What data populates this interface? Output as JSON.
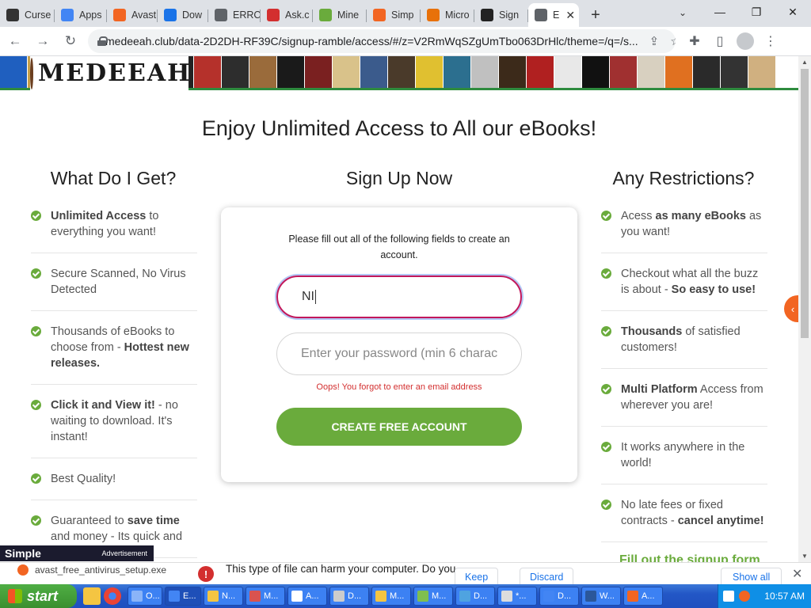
{
  "browser": {
    "tabs": [
      {
        "label": "Curse",
        "icon": "cursor-icon",
        "color": "#333333"
      },
      {
        "label": "Apps",
        "icon": "apps-grid-icon",
        "color": "#4285f4"
      },
      {
        "label": "Avast",
        "icon": "avast-icon",
        "color": "#f26522"
      },
      {
        "label": "Dow",
        "icon": "download-icon",
        "color": "#1a73e8"
      },
      {
        "label": "ERRC",
        "icon": "globe-icon",
        "color": "#5f6368"
      },
      {
        "label": "Ask.c",
        "icon": "ask-icon",
        "color": "#d32f2f"
      },
      {
        "label": "Mine",
        "icon": "dp-icon",
        "color": "#6aab3c"
      },
      {
        "label": "Simp",
        "icon": "simple-icon",
        "color": "#f26522"
      },
      {
        "label": "Micro",
        "icon": "rainbow-icon",
        "color": "#e8710a"
      },
      {
        "label": "Sign",
        "icon": "github-icon",
        "color": "#222222"
      },
      {
        "label": "E",
        "icon": "page-icon",
        "color": "#5f6368"
      }
    ],
    "url": "medeeah.club/data-2D2DH-RF39C/signup-ramble/access/#/z=V2RmWqSZgUmTbo063DrHlc/theme=/q=/s..."
  },
  "site": {
    "logo_text": "MEDEEAH",
    "headline": "Enjoy Unlimited Access to All our eBooks!",
    "left_title": "What Do I Get?",
    "center_title": "Sign Up Now",
    "right_title": "Any Restrictions?",
    "left_features": [
      {
        "bold": "Unlimited Access",
        "rest": " to everything you want!"
      },
      {
        "bold": "",
        "rest": "Secure Scanned, No Virus Detected"
      },
      {
        "pre": "Thousands of eBooks to choose from - ",
        "bold": "Hottest new releases."
      },
      {
        "bold": "Click it and View it!",
        "rest": " - no waiting to download. It's instant!"
      },
      {
        "bold": "",
        "rest": "Best Quality!"
      },
      {
        "pre": "Guaranteed to ",
        "bold": "save time",
        "rest": " and money - Its quick and"
      }
    ],
    "right_features": [
      {
        "pre": "Acess ",
        "bold": "as many eBooks",
        "rest": " as you want!"
      },
      {
        "pre": "Checkout what all the buzz is about - ",
        "bold": "So easy to use!"
      },
      {
        "bold": "Thousands",
        "rest": " of satisfied customers!"
      },
      {
        "bold": "Multi Platform",
        "rest": " Access from wherever you are!"
      },
      {
        "bold": "",
        "rest": "It works anywhere in the world!"
      },
      {
        "pre": "No late fees or fixed contracts - ",
        "bold": "cancel anytime!"
      }
    ],
    "signup_peek": "Fill out the signup form",
    "form": {
      "intro": "Please fill out all of the following fields to create an account.",
      "email_value": "NI",
      "password_placeholder": "Enter your password (min 6 charac",
      "error": "Oops! You forgot to enter an email address",
      "submit": "CREATE FREE ACCOUNT"
    }
  },
  "ad": {
    "brand": "Simple",
    "label": "Advertisement"
  },
  "download_bar": {
    "file": "avast_free_antivirus_setup.exe",
    "warning": "This type of file can harm your computer. Do you",
    "keep": "Keep",
    "discard": "Discard",
    "show_all": "Show all"
  },
  "taskbar": {
    "start": "start",
    "items": [
      "O...",
      "E...",
      "N...",
      "M...",
      "A...",
      "D...",
      "M...",
      "M...",
      "D...",
      "*...",
      "D...",
      "W...",
      "A..."
    ],
    "clock": "10:57 AM"
  }
}
